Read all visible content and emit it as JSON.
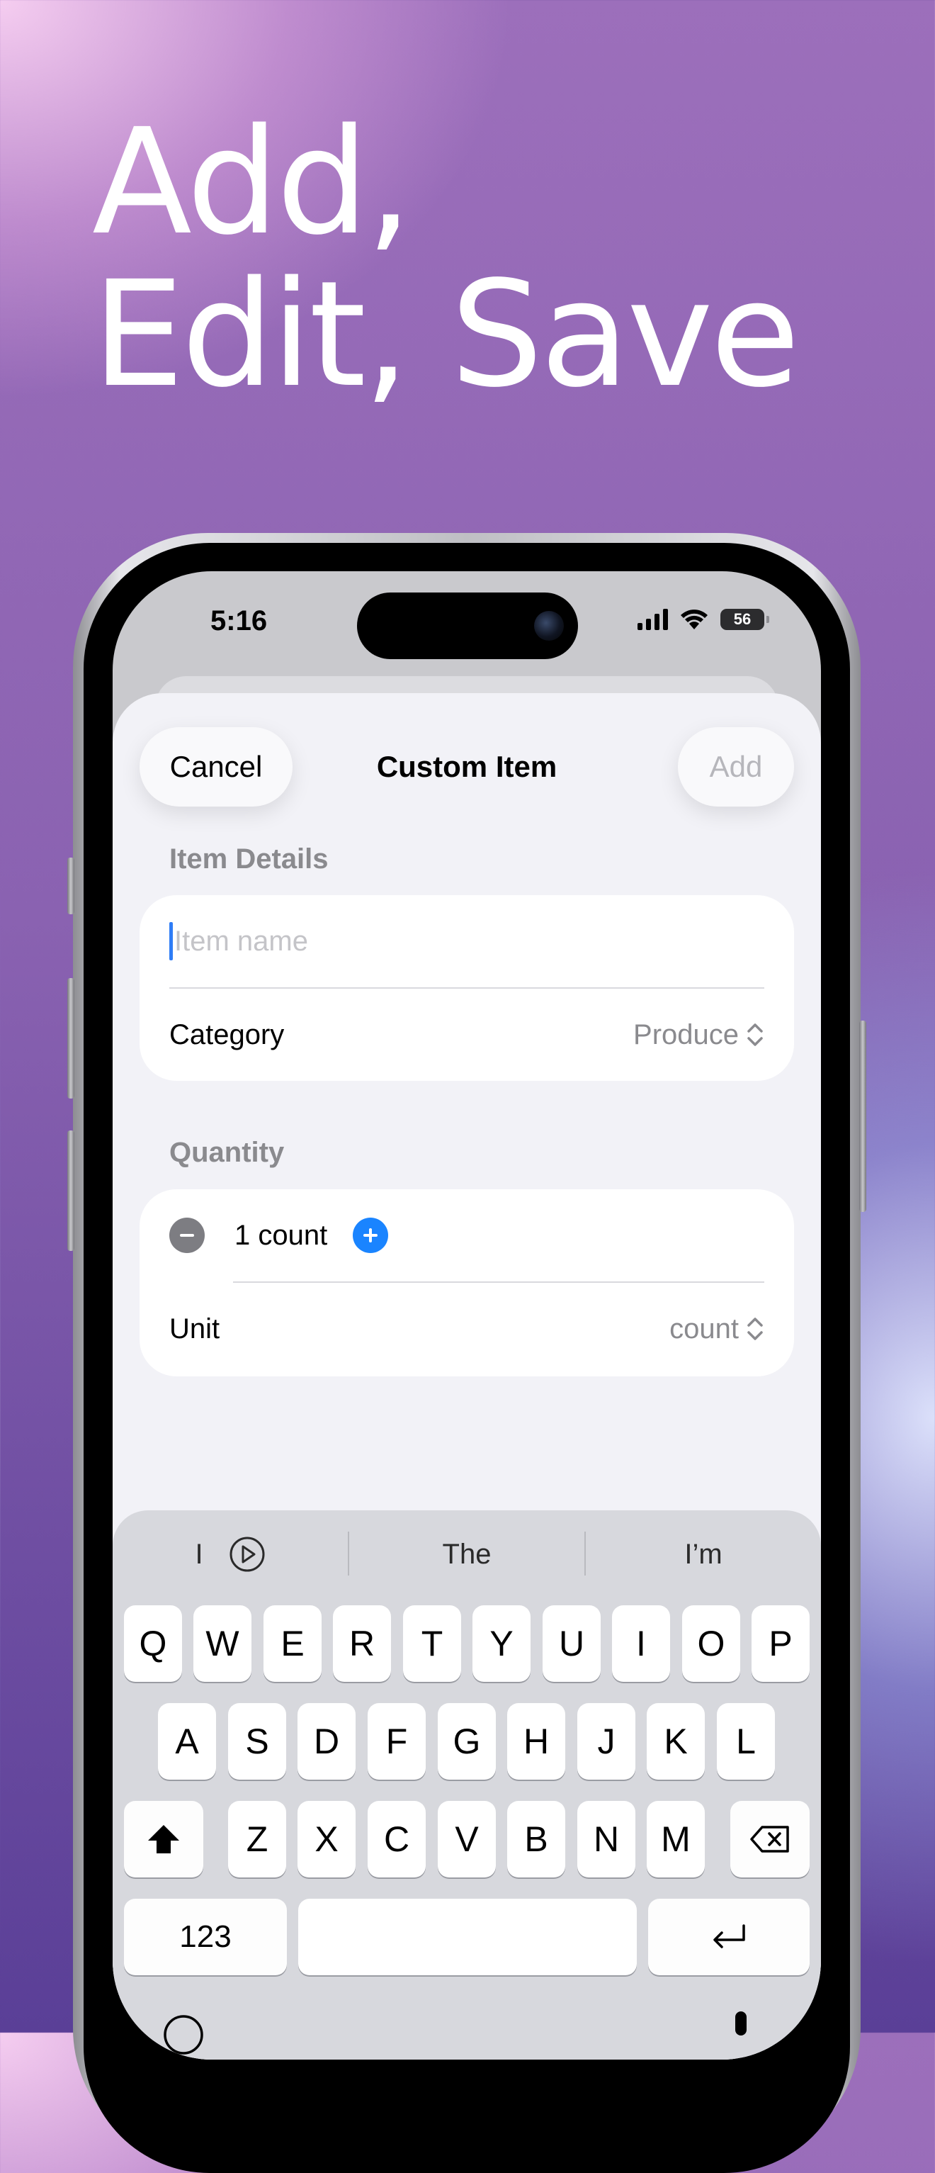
{
  "headline": {
    "line1": "Add,",
    "line2": "Edit, Save"
  },
  "status_bar": {
    "time": "5:16",
    "battery": "56"
  },
  "nav": {
    "cancel": "Cancel",
    "title": "Custom Item",
    "add": "Add"
  },
  "item_details": {
    "header": "Item Details",
    "name_placeholder": "Item name",
    "category_label": "Category",
    "category_value": "Produce"
  },
  "quantity": {
    "header": "Quantity",
    "value": "1 count",
    "unit_label": "Unit",
    "unit_value": "count"
  },
  "keyboard": {
    "suggestions": [
      "I",
      "The",
      "I’m"
    ],
    "row1": [
      "Q",
      "W",
      "E",
      "R",
      "T",
      "Y",
      "U",
      "I",
      "O",
      "P"
    ],
    "row2": [
      "A",
      "S",
      "D",
      "F",
      "G",
      "H",
      "J",
      "K",
      "L"
    ],
    "row3": [
      "Z",
      "X",
      "C",
      "V",
      "B",
      "N",
      "M"
    ],
    "numbers_key": "123"
  },
  "colors": {
    "accent": "#1a84ff",
    "placeholder": "#c4c4c8",
    "secondary_text": "#8a8a8e"
  }
}
